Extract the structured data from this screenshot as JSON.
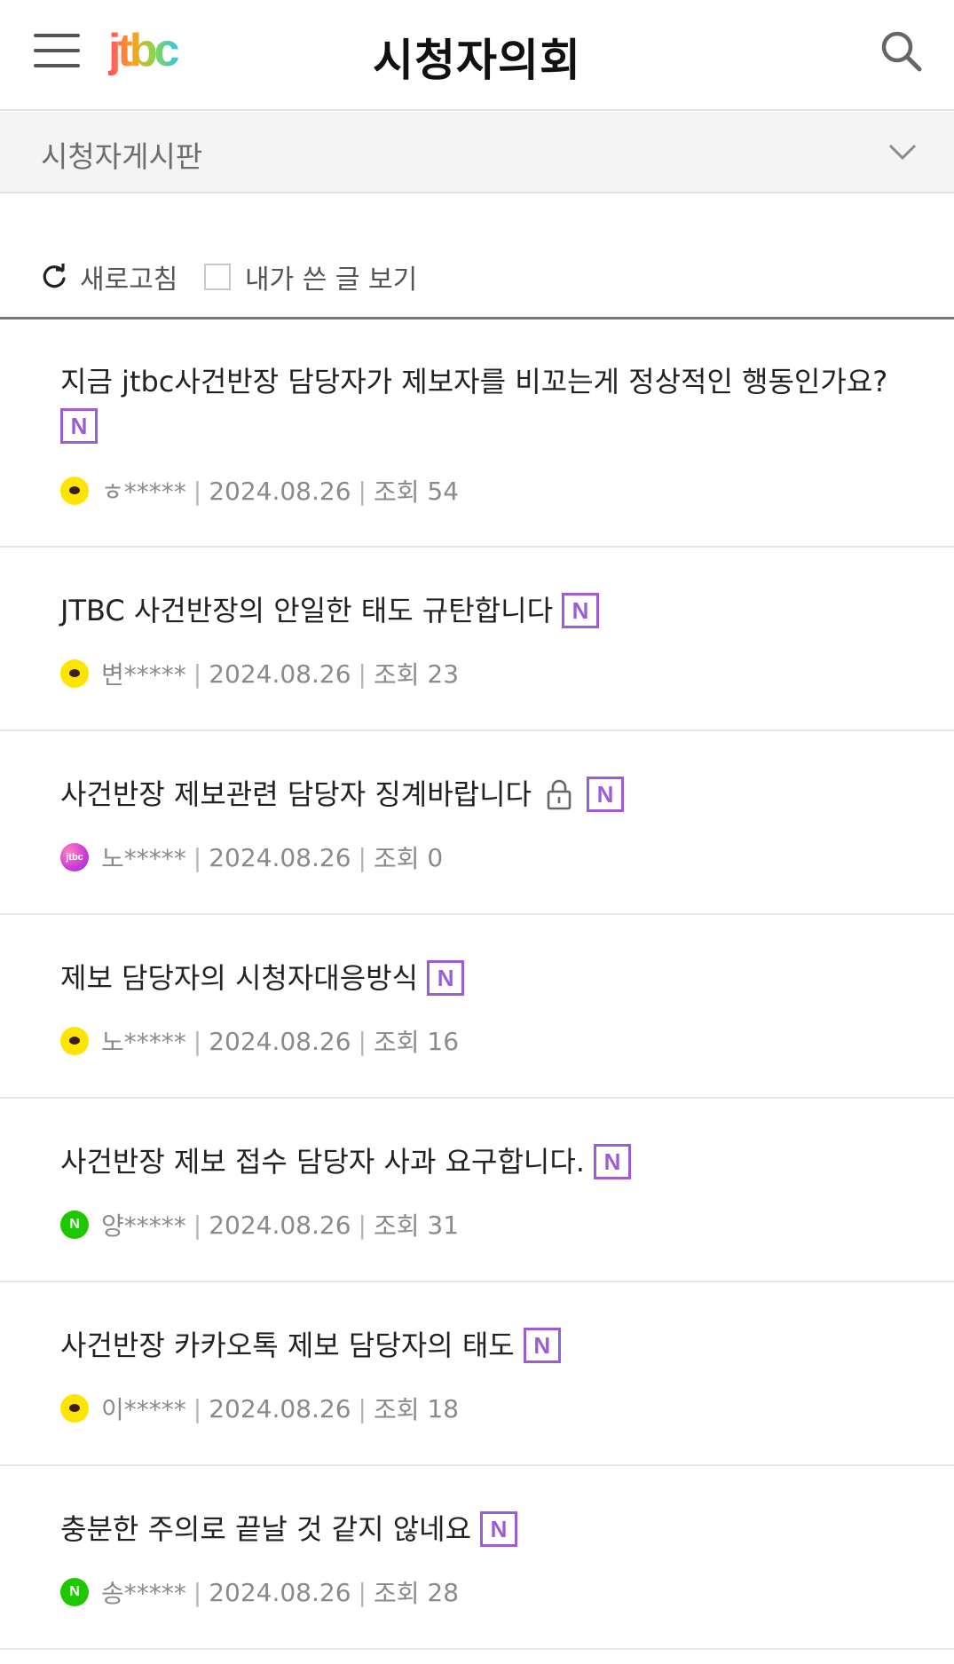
{
  "header": {
    "title": "시청자의회",
    "logo_text": "jtbc",
    "menu_icon": "hamburger-menu-icon",
    "search_icon": "search-icon"
  },
  "board_selector": {
    "label": "시청자게시판",
    "icon": "chevron-down-icon"
  },
  "toolbar": {
    "refresh_label": "새로고침",
    "my_posts_label": "내가 쓴 글 보기"
  },
  "badge_new_label": "N",
  "posts": [
    {
      "title": "지금 jtbc사건반장 담당자가 제보자를 비꼬는게 정상적인 행동인가요?",
      "author": "ㅎ*****",
      "date": "2024.08.26",
      "views_label": "조회",
      "views": "54",
      "login_type": "kakao",
      "locked": false,
      "is_new": true
    },
    {
      "title": "JTBC 사건반장의 안일한 태도 규탄합니다",
      "author": "변*****",
      "date": "2024.08.26",
      "views_label": "조회",
      "views": "23",
      "login_type": "kakao",
      "locked": false,
      "is_new": true
    },
    {
      "title": "사건반장 제보관련 담당자 징계바랍니다",
      "author": "노*****",
      "date": "2024.08.26",
      "views_label": "조회",
      "views": "0",
      "login_type": "jtbc",
      "locked": true,
      "is_new": true
    },
    {
      "title": "제보 담당자의 시청자대응방식",
      "author": "노*****",
      "date": "2024.08.26",
      "views_label": "조회",
      "views": "16",
      "login_type": "kakao",
      "locked": false,
      "is_new": true
    },
    {
      "title": "사건반장 제보 접수 담당자 사과 요구합니다.",
      "author": "양*****",
      "date": "2024.08.26",
      "views_label": "조회",
      "views": "31",
      "login_type": "naver",
      "locked": false,
      "is_new": true
    },
    {
      "title": "사건반장 카카오톡 제보 담당자의 태도",
      "author": "이*****",
      "date": "2024.08.26",
      "views_label": "조회",
      "views": "18",
      "login_type": "kakao",
      "locked": false,
      "is_new": true
    },
    {
      "title": "충분한 주의로 끝날 것 같지 않네요",
      "author": "송*****",
      "date": "2024.08.26",
      "views_label": "조회",
      "views": "28",
      "login_type": "naver",
      "locked": false,
      "is_new": true
    }
  ],
  "colors": {
    "new_badge": "#9b5cd6",
    "kakao": "#fee500",
    "naver": "#1ec800",
    "divider_strong": "#777777",
    "meta_text": "#8a8a8a"
  }
}
